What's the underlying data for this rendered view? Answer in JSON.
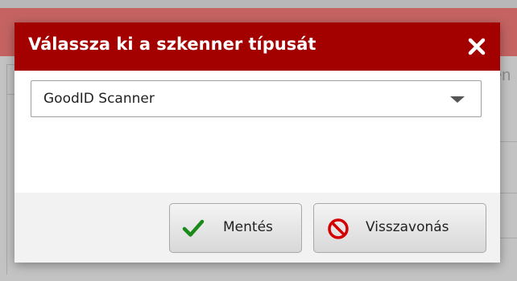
{
  "background": {
    "ghost_text": "én"
  },
  "dialog": {
    "title": "Válassza ki a szkenner típusát",
    "close_icon": "close-icon",
    "scanner_select": {
      "selected_value": "GoodID Scanner",
      "arrow_icon": "chevron-down-icon"
    },
    "buttons": {
      "save_label": "Mentés",
      "save_icon": "check-icon",
      "cancel_label": "Visszavonás",
      "cancel_icon": "prohibited-icon"
    }
  },
  "colors": {
    "titlebar": "#a30000",
    "save_icon": "#1a8a1a",
    "cancel_icon": "#d40000",
    "background_header": "#c56363"
  }
}
